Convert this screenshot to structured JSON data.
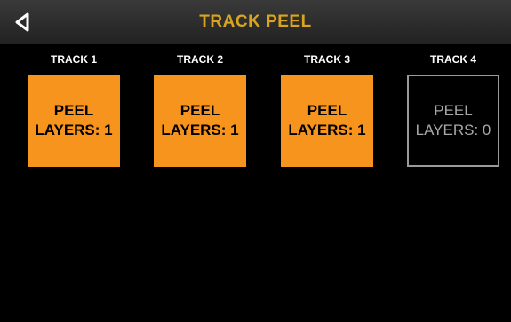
{
  "header": {
    "title": "TRACK PEEL",
    "back_icon": "back-triangle-icon",
    "title_color": "#d9a41e"
  },
  "tracks": [
    {
      "label": "TRACK 1",
      "line1": "PEEL",
      "line2": "LAYERS: 1",
      "state": "active"
    },
    {
      "label": "TRACK 2",
      "line1": "PEEL",
      "line2": "LAYERS: 1",
      "state": "active"
    },
    {
      "label": "TRACK 3",
      "line1": "PEEL",
      "line2": "LAYERS: 1",
      "state": "active"
    },
    {
      "label": "TRACK 4",
      "line1": "PEEL",
      "line2": "LAYERS: 0",
      "state": "inactive"
    }
  ],
  "colors": {
    "active_pad": "#f7941d",
    "inactive_border": "#9a9a9a",
    "background": "#000000"
  }
}
